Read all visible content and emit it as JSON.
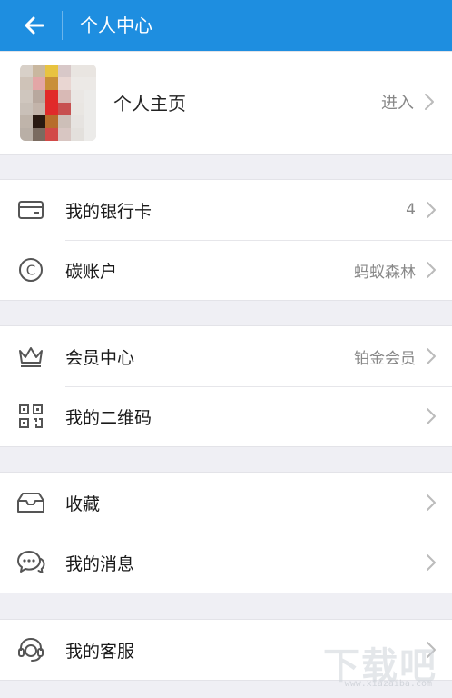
{
  "appbar": {
    "title": "个人中心",
    "back_icon": "arrow-left-icon"
  },
  "profile": {
    "label": "个人主页",
    "action": "进入"
  },
  "sections": [
    [
      {
        "name": "bank-card",
        "icon": "card-icon",
        "label": "我的银行卡",
        "value": "4"
      },
      {
        "name": "carbon-account",
        "icon": "carbon-c-icon",
        "label": "碳账户",
        "value": "蚂蚁森林"
      }
    ],
    [
      {
        "name": "member-center",
        "icon": "crown-icon",
        "label": "会员中心",
        "value": "铂金会员"
      },
      {
        "name": "qr-code",
        "icon": "qrcode-icon",
        "label": "我的二维码",
        "value": ""
      }
    ],
    [
      {
        "name": "favorites",
        "icon": "inbox-icon",
        "label": "收藏",
        "value": ""
      },
      {
        "name": "messages",
        "icon": "chat-bubbles-icon",
        "label": "我的消息",
        "value": ""
      }
    ],
    [
      {
        "name": "customer-service",
        "icon": "headset-icon",
        "label": "我的客服",
        "value": ""
      }
    ]
  ],
  "watermark": {
    "text": "下载吧",
    "url": "www.xiazaiba.com"
  },
  "colors": {
    "brand": "#1e8ee0",
    "background": "#efeff4",
    "icon": "#555555"
  }
}
